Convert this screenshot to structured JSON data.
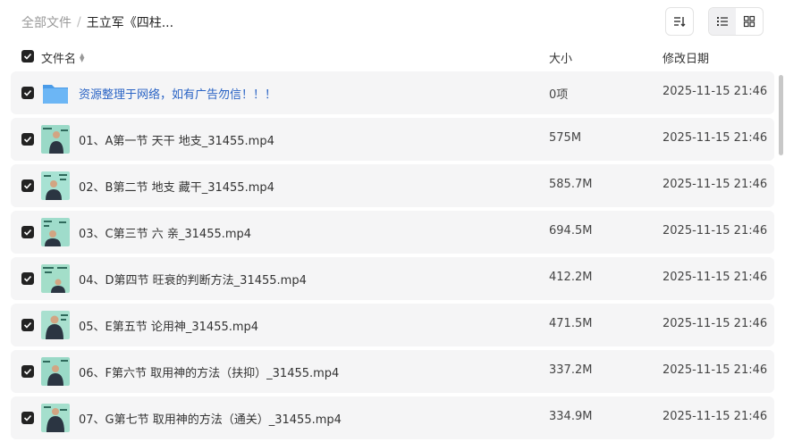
{
  "breadcrumb": {
    "root": "全部文件",
    "separator": "/",
    "current": "王立军《四柱..."
  },
  "toolbar": {
    "sort_icon": "sort-icon",
    "list_view_icon": "list-view-icon",
    "grid_view_icon": "grid-view-icon",
    "active_view": "list"
  },
  "columns": {
    "name": "文件名",
    "size": "大小",
    "date": "修改日期"
  },
  "rows": [
    {
      "type": "folder",
      "name": "资源整理于网络，如有广告勿信！！！",
      "size": "0项",
      "date": "2025-11-15 21:46"
    },
    {
      "type": "video",
      "name": "01、A第一节 天干 地支_31455.mp4",
      "size": "575M",
      "date": "2025-11-15 21:46"
    },
    {
      "type": "video",
      "name": "02、B第二节 地支 藏干_31455.mp4",
      "size": "585.7M",
      "date": "2025-11-15 21:46"
    },
    {
      "type": "video",
      "name": "03、C第三节 六 亲_31455.mp4",
      "size": "694.5M",
      "date": "2025-11-15 21:46"
    },
    {
      "type": "video",
      "name": "04、D第四节 旺衰的判断方法_31455.mp4",
      "size": "412.2M",
      "date": "2025-11-15 21:46"
    },
    {
      "type": "video",
      "name": "05、E第五节 论用神_31455.mp4",
      "size": "471.5M",
      "date": "2025-11-15 21:46"
    },
    {
      "type": "video",
      "name": "06、F第六节 取用神的方法（扶抑）_31455.mp4",
      "size": "337.2M",
      "date": "2025-11-15 21:46"
    },
    {
      "type": "video",
      "name": "07、G第七节 取用神的方法（通关）_31455.mp4",
      "size": "334.9M",
      "date": "2025-11-15 21:46"
    }
  ],
  "colors": {
    "folder": "#5aa9f0",
    "folder_name": "#2a64c5",
    "checkbox": "#222222",
    "row_bg": "#f5f5f6",
    "board": "#9ad9c7"
  }
}
